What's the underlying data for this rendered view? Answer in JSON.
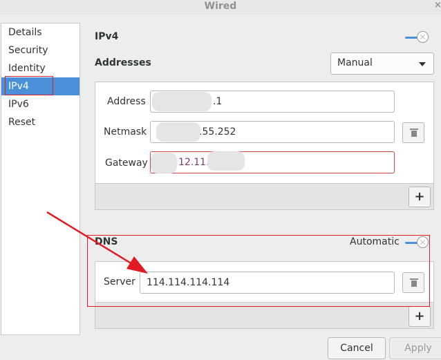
{
  "window": {
    "title": "Wired",
    "close_glyph": "×"
  },
  "sidebar": {
    "items": [
      {
        "label": "Details"
      },
      {
        "label": "Security"
      },
      {
        "label": "Identity"
      },
      {
        "label": "IPv4",
        "selected": true
      },
      {
        "label": "IPv6"
      },
      {
        "label": "Reset"
      }
    ]
  },
  "ipv4": {
    "title": "IPv4",
    "enabled": true,
    "addresses": {
      "title": "Addresses",
      "method": "Manual",
      "address_label": "Address",
      "address_value": ".1",
      "netmask_label": "Netmask",
      "netmask_value": ".55.252",
      "gateway_label": "Gateway",
      "gateway_value": "12.11."
    },
    "add_glyph": "+"
  },
  "dns": {
    "title": "DNS",
    "automatic_label": "Automatic",
    "automatic": false,
    "server_label": "Server",
    "server_value": "114.114.114.114",
    "add_glyph": "+"
  },
  "footer": {
    "cancel_label": "Cancel",
    "apply_label": "Apply"
  },
  "colors": {
    "accent": "#4a90d9",
    "annotation": "#e01b24",
    "error_border": "#d64848"
  }
}
